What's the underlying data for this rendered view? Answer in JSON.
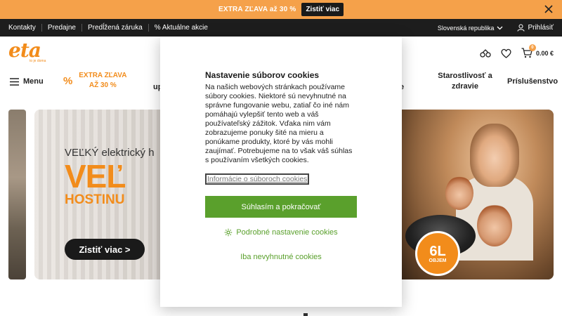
{
  "promo_bar": {
    "text": "EXTRA ZĽAVA až 30 %",
    "button": "Zistiť viac"
  },
  "top_nav": {
    "links": [
      "Kontakty",
      "Predajne",
      "Predĺžená záruka",
      "% Aktuálne akcie"
    ],
    "country": "Slovenská republika",
    "login": "Prihlásiť"
  },
  "header": {
    "logo": "eta",
    "logo_tagline": "to je doma",
    "cart_count": "0",
    "cart_total": "0.00 €"
  },
  "category_nav": {
    "menu": "Menu",
    "promo_label": "EXTRA ZĽAVA AŽ 30 %",
    "partial_left": "up",
    "partial_right": "e",
    "care": "Starostlivosť a zdravie",
    "accessories": "Príslušenstvo"
  },
  "banner": {
    "subtitle": "VEĽKÝ elektrický h",
    "headline": "VEĽ",
    "line2": "HOSTINU",
    "cta": "Zistiť viac >",
    "badge_big": "6L",
    "badge_small": "OBJEM"
  },
  "cookie_modal": {
    "title": "Nastavenie súborov cookies",
    "body": "Na našich webových stránkach používame súbory cookies. Niektoré sú nevyhnutné na správne fungovanie webu, zatiaľ čo iné nám pomáhajú vylepšiť tento web a váš používateľský zážitok. Vďaka nim vám zobrazujeme ponuky šité na mieru a ponúkame produkty, ktoré by vás mohli zaujímať. Potrebujeme na to však váš súhlas s používaním všetkých cookies.",
    "info_link": "Informácie o súboroch cookies",
    "accept": "Súhlasím a pokračovať",
    "detailed": "Podrobné nastavenie cookies",
    "necessary": "Iba nevyhnutné cookies"
  },
  "colors": {
    "brand_orange": "#f28c1b",
    "promo_orange": "#f5a14a",
    "accept_green": "#5aa02c",
    "dark": "#1d1d1d"
  }
}
